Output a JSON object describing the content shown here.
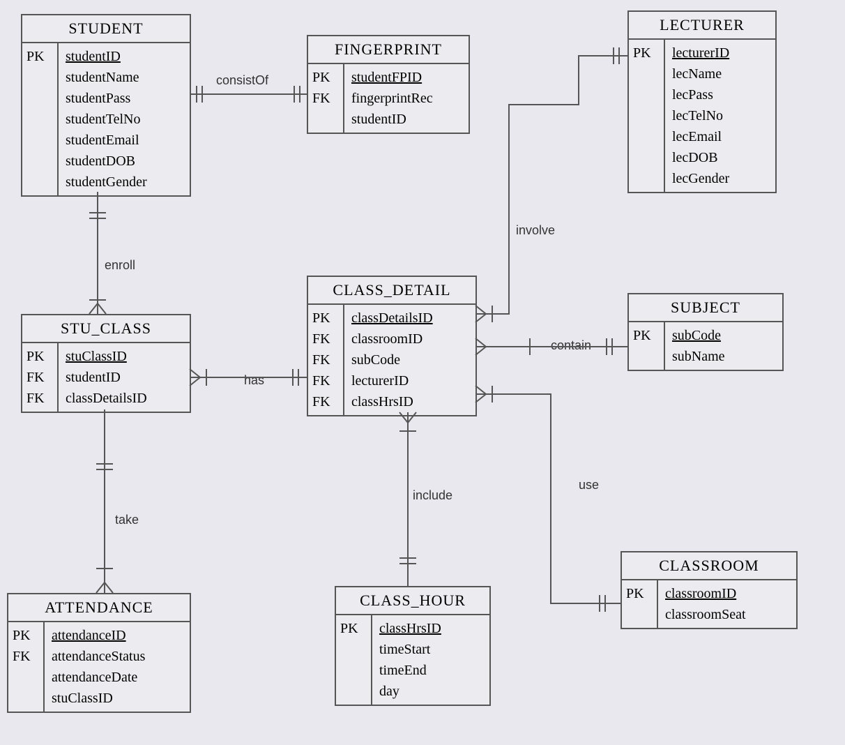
{
  "entities": {
    "student": {
      "title": "STUDENT",
      "keys": [
        "PK",
        "",
        "",
        "",
        "",
        "",
        ""
      ],
      "attrs": [
        "studentID",
        "studentName",
        "studentPass",
        "studentTelNo",
        "studentEmail",
        "studentDOB",
        "studentGender"
      ],
      "pk": [
        true,
        false,
        false,
        false,
        false,
        false,
        false
      ]
    },
    "fingerprint": {
      "title": "FINGERPRINT",
      "keys": [
        "PK",
        "",
        "FK"
      ],
      "attrs": [
        "studentFPID",
        "fingerprintRec",
        "studentID"
      ],
      "pk": [
        true,
        false,
        false
      ]
    },
    "lecturer": {
      "title": "LECTURER",
      "keys": [
        "PK",
        "",
        "",
        "",
        "",
        "",
        ""
      ],
      "attrs": [
        "lecturerID",
        "lecName",
        "lecPass",
        "lecTelNo",
        "lecEmail",
        "lecDOB",
        "lecGender"
      ],
      "pk": [
        true,
        false,
        false,
        false,
        false,
        false,
        false
      ]
    },
    "stu_class": {
      "title": "STU_CLASS",
      "keys": [
        "PK",
        "FK",
        "FK"
      ],
      "attrs": [
        "stuClassID",
        "studentID",
        "classDetailsID"
      ],
      "pk": [
        true,
        false,
        false
      ]
    },
    "class_detail": {
      "title": "CLASS_DETAIL",
      "keys": [
        "PK",
        "FK",
        "FK",
        "FK",
        "FK"
      ],
      "attrs": [
        "classDetailsID",
        "classroomID",
        "subCode",
        "lecturerID",
        "classHrsID"
      ],
      "pk": [
        true,
        false,
        false,
        false,
        false
      ]
    },
    "subject": {
      "title": "SUBJECT",
      "keys": [
        "PK",
        ""
      ],
      "attrs": [
        "subCode",
        "subName"
      ],
      "pk": [
        true,
        false
      ]
    },
    "attendance": {
      "title": "ATTENDANCE",
      "keys": [
        "PK",
        "",
        "",
        "FK"
      ],
      "attrs": [
        "attendanceID",
        "attendanceStatus",
        "attendanceDate",
        "stuClassID"
      ],
      "pk": [
        true,
        false,
        false,
        false
      ]
    },
    "class_hour": {
      "title": "CLASS_HOUR",
      "keys": [
        "PK",
        "",
        "",
        ""
      ],
      "attrs": [
        "classHrsID",
        "timeStart",
        "timeEnd",
        "day"
      ],
      "pk": [
        true,
        false,
        false,
        false
      ]
    },
    "classroom": {
      "title": "CLASSROOM",
      "keys": [
        "PK",
        ""
      ],
      "attrs": [
        "classroomID",
        "classroomSeat"
      ],
      "pk": [
        true,
        false
      ]
    }
  },
  "relationships": {
    "consistOf": "consistOf",
    "enroll": "enroll",
    "has": "has",
    "take": "take",
    "include": "include",
    "involve": "involve",
    "contain": "contain",
    "use": "use"
  }
}
